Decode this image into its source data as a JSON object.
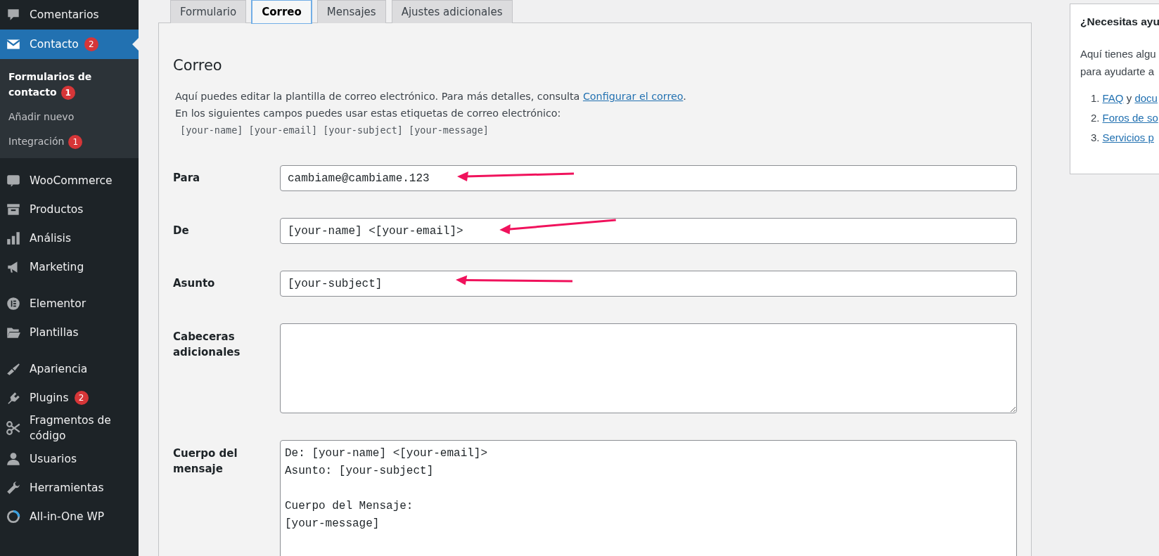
{
  "sidebar": {
    "groups": [
      {
        "items": [
          {
            "label": "Comentarios",
            "selected": false
          },
          {
            "label": "Contacto",
            "selected": true,
            "badge": "2",
            "children": [
              {
                "label": "Formularios de contacto",
                "selected": true,
                "badge": "1"
              },
              {
                "label": "Añadir nuevo",
                "selected": false
              },
              {
                "label": "Integración",
                "selected": false,
                "badge": "1"
              }
            ]
          }
        ]
      },
      {
        "items": [
          {
            "label": "WooCommerce",
            "selected": false
          },
          {
            "label": "Productos",
            "selected": false
          },
          {
            "label": "Análisis",
            "selected": false
          },
          {
            "label": "Marketing",
            "selected": false
          }
        ]
      },
      {
        "items": [
          {
            "label": "Elementor",
            "selected": false
          },
          {
            "label": "Plantillas",
            "selected": false
          }
        ]
      },
      {
        "items": [
          {
            "label": "Apariencia",
            "selected": false
          },
          {
            "label": "Plugins",
            "selected": false,
            "badge": "2"
          },
          {
            "label": "Fragmentos de código",
            "selected": false
          },
          {
            "label": "Usuarios",
            "selected": false
          },
          {
            "label": "Herramientas",
            "selected": false
          },
          {
            "label": "All-in-One WP",
            "selected": false
          }
        ]
      }
    ]
  },
  "tabs": [
    {
      "label": "Formulario",
      "selected": false
    },
    {
      "label": "Correo",
      "selected": true
    },
    {
      "label": "Mensajes",
      "selected": false
    },
    {
      "label": "Ajustes adicionales",
      "selected": false
    }
  ],
  "panel": {
    "heading": "Correo",
    "description": {
      "text": "Aquí puedes editar la plantilla de correo electrónico. Para más detalles, consulta ",
      "link": "Configurar el correo",
      "after": "."
    },
    "note": "En los siguientes campos puedes usar estas etiquetas de correo electrónico:",
    "tags": "[your-name] [your-email] [your-subject] [your-message]",
    "fields": [
      {
        "label": "Para",
        "kind": "input",
        "value": "cambiame@cambiame.123",
        "annotated": true
      },
      {
        "label": "De",
        "kind": "input",
        "value": "[your-name] <[your-email]>",
        "annotated": true
      },
      {
        "label": "Asunto",
        "kind": "input",
        "value": "[your-subject]",
        "annotated": true
      },
      {
        "label": "Cabeceras adicionales",
        "kind": "textarea"
      },
      {
        "label": "Cuerpo del mensaje",
        "kind": "body",
        "value": "De: [your-name] <[your-email]>\nAsunto: [your-subject]\n\nCuerpo del Mensaje:\n[your-message]"
      }
    ]
  },
  "help_box": {
    "title": "¿Necesitas ayu",
    "lines": [
      "Aquí tienes algu",
      "para ayudarte a"
    ],
    "items": [
      {
        "number": "1.",
        "parts": [
          {
            "kind": "link",
            "text": "FAQ"
          },
          {
            "kind": "text",
            "text": " y "
          },
          {
            "kind": "link",
            "text": "docu"
          }
        ]
      },
      {
        "number": "2.",
        "parts": [
          {
            "kind": "link",
            "text": "Foros de so"
          }
        ]
      },
      {
        "number": "3.",
        "parts": [
          {
            "kind": "link",
            "text": "Servicios p"
          }
        ]
      }
    ]
  }
}
